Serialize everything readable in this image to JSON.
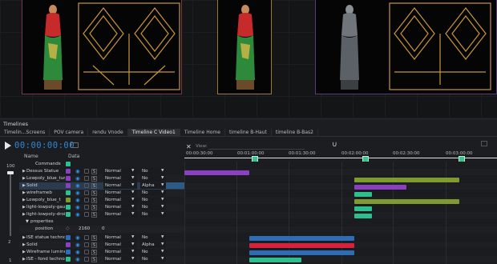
{
  "colors": {
    "accent": "#2f86d8",
    "purple": "#8b3fc1",
    "olive": "#7f9a2e",
    "teal": "#2fbf8f",
    "blue": "#2d6db8",
    "red": "#d6223a"
  },
  "panel": {
    "title": "Timelines",
    "tabs": [
      "Timelin...Screens",
      "POV camera",
      "rendu Vnode",
      "Timeline C Video1",
      "Timeline Home",
      "timeline B-Haut",
      "timeline B-Bas2"
    ],
    "active_tab": 3
  },
  "transport": {
    "timecode": "00:00:00:00",
    "view_label": "View:"
  },
  "columns": {
    "name": "Name",
    "data": "Data"
  },
  "zoom": {
    "top": "100",
    "bottom": "2",
    "extra": "1",
    "level": 1.0
  },
  "ruler": {
    "close_icon": "✕",
    "ticks": [
      "00:00:30:00",
      "00:01:00:00",
      "00:01:30:00",
      "00:02:00:00",
      "00:02:30:00",
      "00:03:00:00"
    ]
  },
  "commands_label": "Commands",
  "layers": [
    {
      "name": "Dessus Statue",
      "color": "#8b3fc1",
      "blend": "Normal",
      "mode": "No"
    },
    {
      "name": "Lowpoly_blue_turb",
      "color": "#8b3fc1",
      "blend": "Normal",
      "mode": "No"
    },
    {
      "name": "Solid",
      "color": "#8b3fc1",
      "blend": "Normal",
      "mode": "Alpha"
    },
    {
      "name": "wireframeb",
      "color": "#2fbf8f",
      "blend": "Normal",
      "mode": "No"
    },
    {
      "name": "Lowpoly_blue_t",
      "color": "#7f9a2e",
      "blend": "Normal",
      "mode": "No"
    },
    {
      "name": "light-lowpoly-gauc",
      "color": "#2fbf8f",
      "blend": "Normal",
      "mode": "No"
    },
    {
      "name": "light-lowpoly-droit",
      "color": "#2fbf8f",
      "blend": "Normal",
      "mode": "No"
    }
  ],
  "properties": {
    "label": "properties",
    "position_label": "position",
    "position_x": "2160",
    "position_y": "0"
  },
  "layers2": [
    {
      "name": "ISE statue techno_t",
      "color": "#2d6db8",
      "blend": "Normal",
      "mode": "No"
    },
    {
      "name": "Solid",
      "color": "#8b3fc1",
      "blend": "Normal",
      "mode": "Alpha"
    },
    {
      "name": "Wireframe lumineu",
      "color": "#2d6db8",
      "blend": "Normal",
      "mode": "No"
    },
    {
      "name": "ISE - fond techno n",
      "color": "#2fbf8f",
      "blend": "Normal",
      "mode": "No"
    }
  ]
}
